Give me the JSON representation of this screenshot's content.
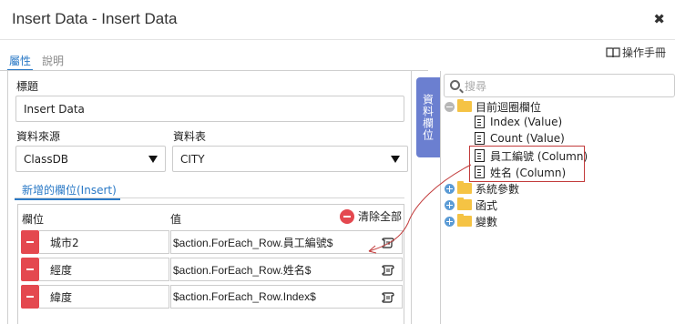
{
  "window": {
    "title": "Insert Data - Insert Data",
    "close_label": "✖"
  },
  "manual": {
    "label": "操作手冊"
  },
  "tabs": [
    {
      "label": "屬性",
      "active": true
    },
    {
      "label": "說明",
      "active": false
    }
  ],
  "form": {
    "title_label": "標題",
    "title_value": "Insert Data",
    "source_label": "資料來源",
    "source_value": "ClassDB",
    "table_label": "資料表",
    "table_value": "CITY"
  },
  "subtab": {
    "label": "新增的欄位(Insert)"
  },
  "grid": {
    "col_field": "欄位",
    "col_value": "值",
    "clear_all": "清除全部",
    "rows": [
      {
        "name": "城市2",
        "value": "$action.ForEach_Row.員工編號$"
      },
      {
        "name": "經度",
        "value": "$action.ForEach_Row.姓名$"
      },
      {
        "name": "緯度",
        "value": "$action.ForEach_Row.Index$"
      }
    ]
  },
  "side_tab": {
    "label": "資料欄位"
  },
  "search": {
    "placeholder": "搜尋"
  },
  "tree": {
    "root": {
      "label": "目前迴圈欄位",
      "expanded": true
    },
    "children": [
      {
        "label": "Index (Value)"
      },
      {
        "label": "Count (Value)"
      },
      {
        "label": "員工編號 (Column)"
      },
      {
        "label": "姓名 (Column)"
      }
    ],
    "others": [
      {
        "label": "系統參數"
      },
      {
        "label": "函式"
      },
      {
        "label": "變數"
      }
    ]
  },
  "colors": {
    "accent": "#2a79c6",
    "remove": "#e4484f",
    "side_tab": "#6b7fd0",
    "folder": "#f5c344",
    "highlight": "#c23b3b"
  }
}
